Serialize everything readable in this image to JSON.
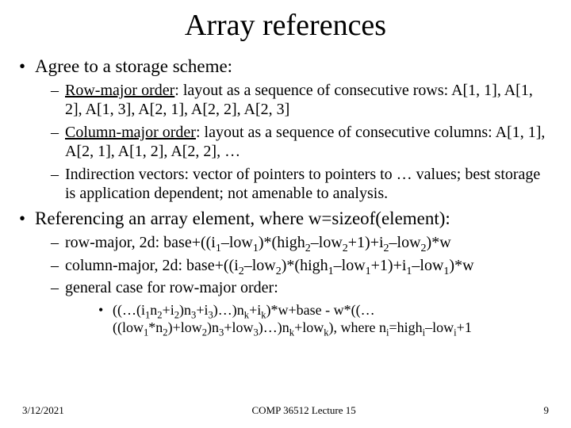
{
  "title": "Array references",
  "bullets": {
    "b1": "Agree to a storage scheme:",
    "b1a_u": "Row-major order",
    "b1a_rest": ": layout as a sequence of consecutive rows: A[1, 1], A[1, 2], A[1, 3], A[2, 1], A[2, 2], A[2, 3]",
    "b1b_u": "Column-major order",
    "b1b_rest": ": layout as a sequence of consecutive columns: A[1, 1], A[2, 1], A[1, 2], A[2, 2], …",
    "b1c": "Indirection vectors: vector of pointers to pointers to … values; best storage is application dependent; not amenable to analysis.",
    "b2": "Referencing an array element, where w=sizeof(element):",
    "b2a_pre": "row-major, 2d: base+((i",
    "b2a_s1": "1",
    "b2a_t1": "–low",
    "b2a_s2": "1",
    "b2a_t2": ")*(high",
    "b2a_s3": "2",
    "b2a_t3": "–low",
    "b2a_s4": "2",
    "b2a_t4": "+1)+i",
    "b2a_s5": "2",
    "b2a_t5": "–low",
    "b2a_s6": "2",
    "b2a_t6": ")*w",
    "b2b_pre": "column-major, 2d: base+((i",
    "b2b_s1": "2",
    "b2b_t1": "–low",
    "b2b_s2": "2",
    "b2b_t2": ")*(high",
    "b2b_s3": "1",
    "b2b_t3": "–low",
    "b2b_s4": "1",
    "b2b_t4": "+1)+i",
    "b2b_s5": "1",
    "b2b_t5": "–low",
    "b2b_s6": "1",
    "b2b_t6": ")*w",
    "b2c": "general case for row-major order:",
    "g_p0": "((…(i",
    "g_s1": "1",
    "g_p1": "n",
    "g_s2": "2",
    "g_p2": "+i",
    "g_s3": "2",
    "g_p3": ")n",
    "g_s4": "3",
    "g_p4": "+i",
    "g_s5": "3",
    "g_p5": ")…)n",
    "g_s6": "k",
    "g_p6": "+i",
    "g_s7": "k",
    "g_p7": ")*w+base - w*((…((low",
    "g_s8": "1",
    "g_p8": "*n",
    "g_s9": "2",
    "g_p9": ")+low",
    "g_s10": "2",
    "g_p10": ")n",
    "g_s11": "3",
    "g_p11": "+low",
    "g_s12": "3",
    "g_p12": ")…)n",
    "g_s13": "k",
    "g_p13": "+low",
    "g_s14": "k",
    "g_p14": "), where n",
    "g_s15": "i",
    "g_p15": "=high",
    "g_s16": "i",
    "g_p16": "–low",
    "g_s17": "i",
    "g_p17": "+1"
  },
  "footer": {
    "date": "3/12/2021",
    "course": "COMP 36512 Lecture 15",
    "page": "9"
  }
}
